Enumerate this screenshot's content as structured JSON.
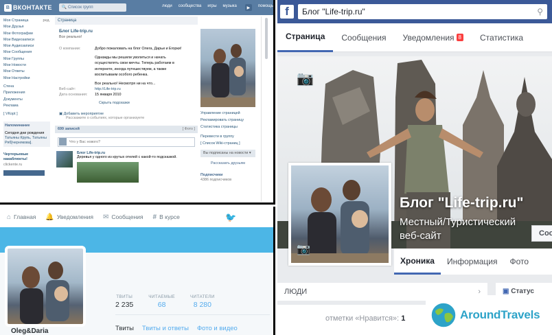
{
  "vk": {
    "logo": "ВКОНТАКТЕ",
    "search_placeholder": "Список групп",
    "topnav": [
      "люди",
      "сообщества",
      "игры",
      "музыка",
      "помощь"
    ],
    "sidebar": {
      "items": [
        "Моя Страница",
        "Мои Друзья",
        "Мои Фотографии",
        "Мои Видеозаписи",
        "Мои Аудиозаписи",
        "Мои Сообщения",
        "Мои Группы",
        "Мои Новости",
        "Мои Ответы",
        "Мои Настройки"
      ],
      "edit_label": "ред.",
      "extra": [
        "Стена",
        "Приложения",
        "Документы",
        "Реклама"
      ],
      "vkopt": "[ VKopt ]",
      "reminder_title": "Напоминание",
      "reminder_text_1": "Сегодня",
      "reminder_text_2": "дни",
      "reminder_text_3": "рождения",
      "reminder_names": "Татьяны Крупь, Татьяны Ряб[чернякова].",
      "subscribe_title": "Чертерьевые накаблюкты!",
      "subscribe_link": "clickente.ru"
    },
    "main": {
      "tab": "Страница",
      "name": "Блог Life-trip.ru",
      "status": "Все реально!",
      "about_label": "О компании:",
      "about_lines": [
        "Добро пожаловать на блог Олега, Дарьи и Егорки!",
        "Однажды мы решили уволиться и начать",
        "осуществлять свои мечты. Теперь работаем в",
        "интернете, иногда путешествуем, а также",
        "воспитываем особого ребенка.",
        "Все реально! Несмотря ни на что..."
      ],
      "site_label": "Веб-сайт:",
      "site_value": "http://Life-trip.ru",
      "founded_label": "Дата основания:",
      "founded_value": "15 января 2010",
      "hide_link": "Скрыть подсказки",
      "event_link": "Добавить мероприятие",
      "event_hint": "Расскажите о событиях, которые организуете",
      "posts_count": "699 записей",
      "posts_hide": "[ Фото ]",
      "input_placeholder": "Что у Вас нового?",
      "post_author": "Блог Life-trip.ru",
      "post_text": "Деревья у одного из крутых отелей с какой-то подсказкой."
    },
    "right": {
      "links": [
        "Управление страницей",
        "Рекламировать страницу",
        "Статистика страницы",
        "Перевести в группу",
        "[ Список Wiki-страниц ]"
      ],
      "dropdown": "Вы подписаны на новости",
      "tell_friends": "Рассказать друзьям",
      "subscribers_title": "Подписчики",
      "subscribers_count": "4386 подписчиков"
    }
  },
  "twitter": {
    "nav": [
      "Главная",
      "Уведомления",
      "Сообщения",
      "В курсе"
    ],
    "stats": [
      {
        "label": "ТВИТЫ",
        "value": "2 235"
      },
      {
        "label": "ЧИТАЕМЫЕ",
        "value": "68"
      },
      {
        "label": "ЧИТАТЕЛИ",
        "value": "8 280"
      }
    ],
    "tabs": [
      "Твиты",
      "Твиты и ответы",
      "Фото и видео"
    ],
    "handle": "Oleg&Daria"
  },
  "facebook": {
    "search_value": "Блог \"Life-trip.ru\"",
    "tabs": [
      "Страница",
      "Сообщения",
      "Уведомления",
      "Статистика"
    ],
    "notif_badge": "8",
    "page_title": "Блог \"Life-trip.ru\"",
    "category_line1": "Местный/Туристический",
    "category_line2": "веб-сайт",
    "message_button": "Соо",
    "subtabs": [
      "Хроника",
      "Информация",
      "Фото"
    ],
    "people_label": "ЛЮДИ",
    "likes_text": "отметки «Нравится»:",
    "likes_value": "1",
    "status_label": "Статус"
  },
  "watermark": {
    "text": "AroundTravels"
  }
}
